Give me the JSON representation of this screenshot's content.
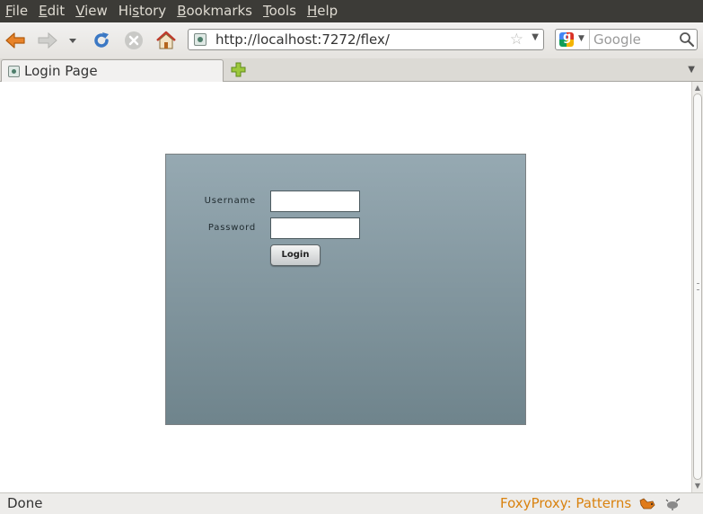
{
  "menu": {
    "items": [
      {
        "label": "File",
        "accel": "F",
        "rest": "ile"
      },
      {
        "label": "Edit",
        "accel": "E",
        "rest": "dit"
      },
      {
        "label": "View",
        "accel": "V",
        "rest": "iew"
      },
      {
        "label": "History",
        "pre": "Hi",
        "accel": "s",
        "rest": "tory"
      },
      {
        "label": "Bookmarks",
        "accel": "B",
        "rest": "ookmarks"
      },
      {
        "label": "Tools",
        "accel": "T",
        "rest": "ools"
      },
      {
        "label": "Help",
        "accel": "H",
        "rest": "elp"
      }
    ]
  },
  "nav": {
    "url": "http://localhost:7272/flex/",
    "search_placeholder": "Google",
    "icons": [
      "back-arrow-icon",
      "forward-arrow-icon",
      "history-dropdown-icon",
      "reload-icon",
      "stop-icon",
      "home-icon"
    ]
  },
  "tabs": [
    {
      "label": "Login Page"
    }
  ],
  "login": {
    "username_label": "Username",
    "password_label": "Password",
    "username_value": "",
    "password_value": "",
    "button_label": "Login"
  },
  "status": {
    "text": "Done",
    "proxy_text": "FoxyProxy: Patterns"
  },
  "colors": {
    "menubar": "#3c3b37",
    "panel_top": "#96a9b2",
    "panel_bottom": "#6f848c",
    "proxy_text": "#d9820f"
  }
}
